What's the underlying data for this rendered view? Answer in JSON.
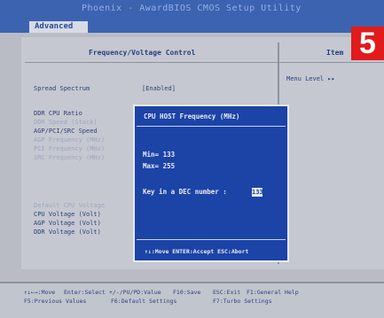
{
  "title": "Phoenix - AwardBIOS CMOS Setup Utility",
  "tab": "Advanced",
  "panel_title": "Frequency/Voltage Control",
  "help_title": "Item",
  "help_menu": "Menu Level  ▸▸",
  "items": [
    {
      "label": "Spread Spectrum",
      "value": "[Enabled]"
    },
    {
      "label": "DDR CPU Ratio"
    },
    {
      "label": "DDR Speed (Stock)"
    },
    {
      "label": "AGP/PCI/SRC Speed"
    },
    {
      "label": "AGP Frequency (MHz)"
    },
    {
      "label": "PCI Frequency (MHz)"
    },
    {
      "label": "SRC Frequency (MHz)"
    },
    {
      "label": "Default CPU Voltage"
    },
    {
      "label": "CPU Voltage (Volt)"
    },
    {
      "label": "AGP Voltage (Volt)"
    },
    {
      "label": "DDR Voltage (Volt)"
    }
  ],
  "dialog": {
    "title": "CPU HOST Frequency (MHz)",
    "min_label": "Min=  133",
    "max_label": "Max=  255",
    "prompt": "Key in a DEC number :",
    "input_value": "133",
    "footer": "↑↓:Move ENTER:Accept ESC:Abort"
  },
  "keys": {
    "row1": [
      "↑↓←→:Move",
      "Enter:Select",
      "+/-/PU/PD:Value",
      "F10:Save",
      "ESC:Exit",
      "F1:General Help"
    ],
    "row2": [
      "F5:Previous Values",
      "F6:Default Settings",
      "F7:Turbo Settings"
    ]
  },
  "badge": "5"
}
